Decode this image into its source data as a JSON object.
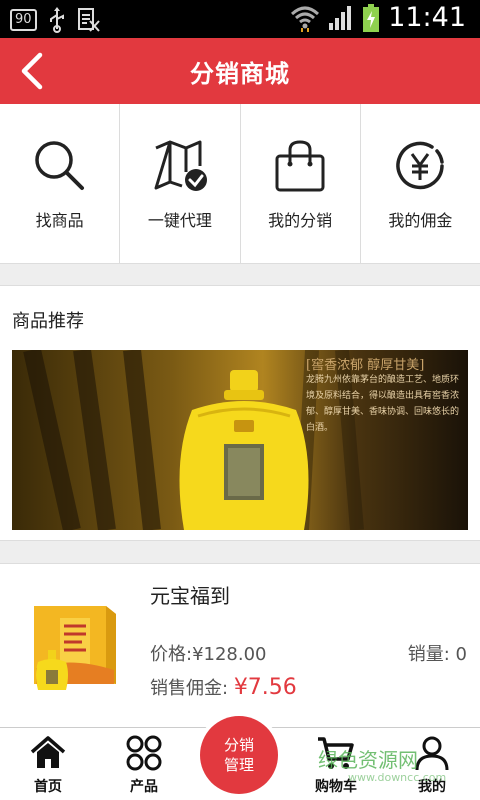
{
  "status_bar": {
    "badge": "90",
    "time": "11:41"
  },
  "header": {
    "title": "分销商城"
  },
  "quick_actions": [
    {
      "label": "找商品",
      "icon": "search-icon"
    },
    {
      "label": "一键代理",
      "icon": "map-check-icon"
    },
    {
      "label": "我的分销",
      "icon": "shopping-bag-icon"
    },
    {
      "label": "我的佣金",
      "icon": "yen-coin-icon"
    }
  ],
  "recommend": {
    "title": "商品推荐",
    "banner_tag": "[窖香浓郁  醇厚甘美]",
    "banner_copy": "龙腾九州依靠茅台的酿造工艺、地质环境及原料结合，得以酿造出具有窖香浓郁、醇厚甘美、香味协调、回味悠长的白酒。"
  },
  "product": {
    "name": "元宝福到",
    "price_label": "价格:",
    "price": "¥128.00",
    "sales_label": "销量:",
    "sales": "0",
    "commission_label": "销售佣金:",
    "commission": "¥7.56"
  },
  "bottom_nav": {
    "home": "首页",
    "products": "产品",
    "center_line1": "分销",
    "center_line2": "管理",
    "cart": "购物车",
    "mine": "我的"
  },
  "watermark": {
    "text": "绿色资源网",
    "url": "www.downcc.com"
  },
  "colors": {
    "brand": "#e2393f",
    "background": "#eeeeee"
  }
}
